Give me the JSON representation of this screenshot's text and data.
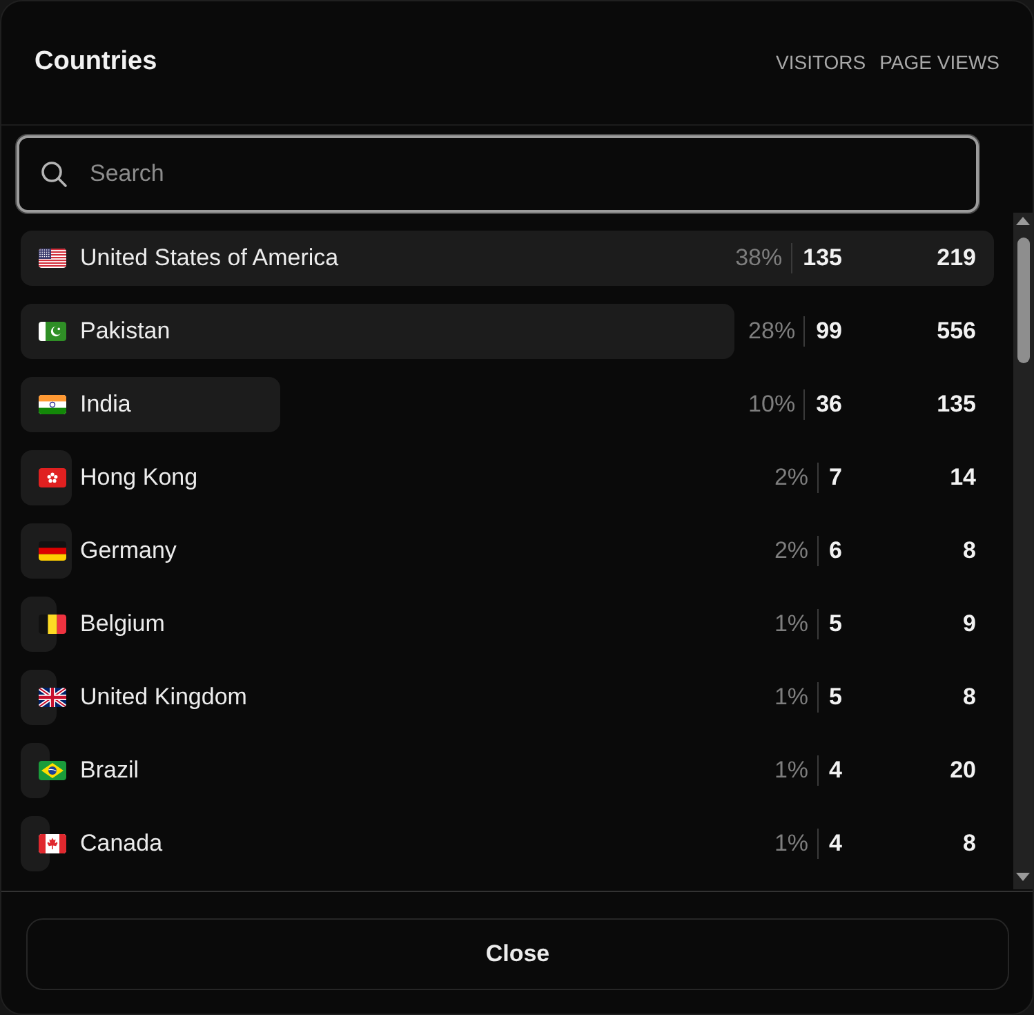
{
  "modal": {
    "title": "Countries",
    "column_headers": [
      "VISITORS",
      "PAGE VIEWS"
    ]
  },
  "search": {
    "placeholder": "Search"
  },
  "rows": [
    {
      "kind": "us",
      "country": "United States of America",
      "share": "38%",
      "visitors": "135",
      "page_views": "219",
      "level": 1
    },
    {
      "kind": "pk",
      "country": "Pakistan",
      "share": "28%",
      "visitors": "99",
      "page_views": "556",
      "level": 0.733
    },
    {
      "kind": "in",
      "country": "India",
      "share": "10%",
      "visitors": "36",
      "page_views": "135",
      "level": 0.267
    },
    {
      "kind": "hk",
      "country": "Hong Kong",
      "share": "2%",
      "visitors": "7",
      "page_views": "14",
      "level": 0.052
    },
    {
      "kind": "de",
      "country": "Germany",
      "share": "2%",
      "visitors": "6",
      "page_views": "8",
      "level": 0.052
    },
    {
      "kind": "be",
      "country": "Belgium",
      "share": "1%",
      "visitors": "5",
      "page_views": "9",
      "level": 0.037
    },
    {
      "kind": "gb",
      "country": "United Kingdom",
      "share": "1%",
      "visitors": "5",
      "page_views": "8",
      "level": 0.037
    },
    {
      "kind": "br",
      "country": "Brazil",
      "share": "1%",
      "visitors": "4",
      "page_views": "20",
      "level": 0.03
    },
    {
      "kind": "ca",
      "country": "Canada",
      "share": "1%",
      "visitors": "4",
      "page_views": "8",
      "level": 0.03
    }
  ],
  "footer": {
    "button": "Close"
  }
}
